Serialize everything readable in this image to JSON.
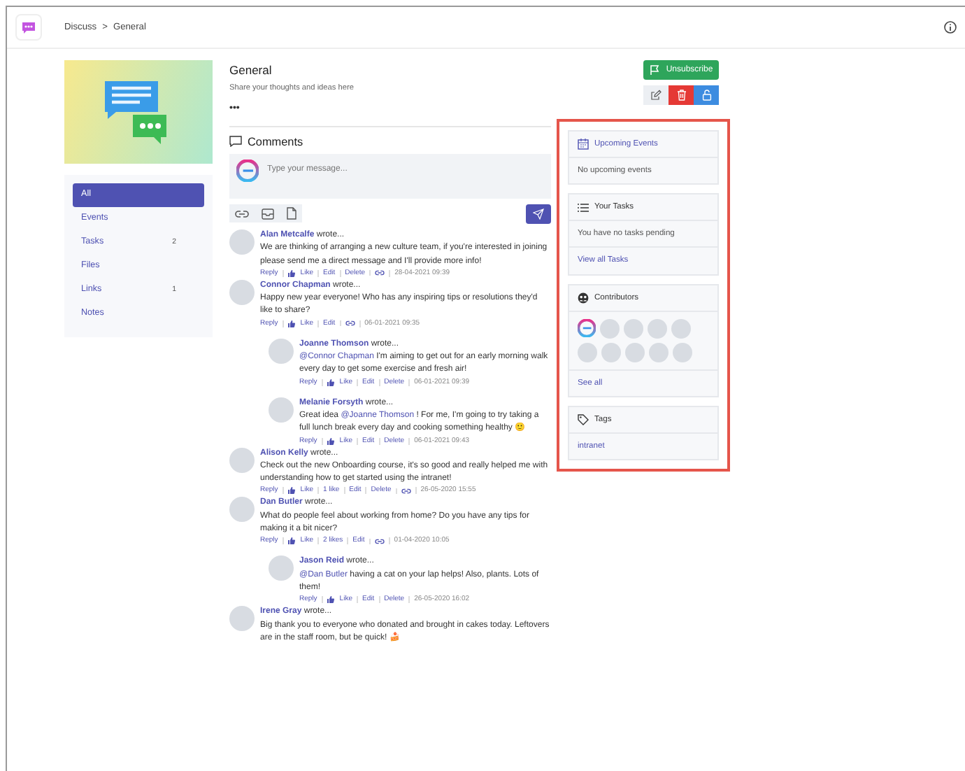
{
  "header": {
    "breadcrumb": [
      "Discuss",
      "General"
    ],
    "separator": ">"
  },
  "group": {
    "title": "General",
    "description": "Share your thoughts and ideas here",
    "menu": "•••"
  },
  "unsubscribe": "Unsubscribe",
  "icon_buttons": [
    {
      "kind": "edit"
    },
    {
      "kind": "delete"
    },
    {
      "kind": "lock"
    }
  ],
  "nav": [
    {
      "label": "All",
      "selected": true
    },
    {
      "label": "Events",
      "selected": false
    },
    {
      "label": "Tasks",
      "count": "2",
      "selected": false
    },
    {
      "label": "Files",
      "selected": false
    },
    {
      "label": "Links",
      "count": "1",
      "selected": false
    },
    {
      "label": "Notes",
      "selected": false
    }
  ],
  "comments_heading": "Comments",
  "composer": {
    "placeholder": "Type your message..."
  },
  "attach_tools": [
    {
      "kind": "link"
    },
    {
      "kind": "inbox"
    },
    {
      "kind": "file"
    }
  ],
  "comments": [
    {
      "author": "Alan Metcalfe",
      "wrote": "wrote...",
      "body": [
        {
          "kind": "text",
          "text": "We are thinking of arranging a new culture team, if you're interested in joining please send me a direct message and I'll provide more info!"
        }
      ],
      "actions": [
        {
          "kind": "reply",
          "text": "Reply"
        },
        {
          "kind": "like",
          "text": "Like"
        },
        {
          "kind": "edit",
          "text": "Edit"
        },
        {
          "kind": "delete",
          "text": "Delete"
        },
        {
          "kind": "permalink"
        },
        {
          "kind": "time",
          "text": "28-04-2021 09:39"
        }
      ]
    },
    {
      "author": "Connor Chapman",
      "wrote": "wrote...",
      "body": [
        {
          "kind": "text",
          "text": "Happy new year everyone! Who has any inspiring tips or resolutions they'd like to share?"
        }
      ],
      "actions": [
        {
          "kind": "reply",
          "text": "Reply"
        },
        {
          "kind": "like",
          "text": "Like"
        },
        {
          "kind": "edit",
          "text": "Edit"
        },
        {
          "kind": "permalink"
        },
        {
          "kind": "time",
          "text": "06-01-2021 09:35"
        }
      ],
      "replies": [
        {
          "author": "Joanne Thomson",
          "wrote": "wrote...",
          "body": [
            {
              "kind": "mention",
              "text": "@Connor Chapman"
            },
            {
              "kind": "text",
              "text": " I'm aiming to get out for an early morning walk every day to get some exercise and fresh air!"
            }
          ],
          "actions": [
            {
              "kind": "reply",
              "text": "Reply"
            },
            {
              "kind": "like",
              "text": "Like"
            },
            {
              "kind": "edit",
              "text": "Edit"
            },
            {
              "kind": "delete",
              "text": "Delete"
            },
            {
              "kind": "time",
              "text": "06-01-2021 09:39"
            }
          ]
        },
        {
          "author": "Melanie Forsyth",
          "wrote": "wrote...",
          "body": [
            {
              "kind": "text",
              "text": "Great idea "
            },
            {
              "kind": "mention",
              "text": "@Joanne Thomson"
            },
            {
              "kind": "text",
              "text": " ! For me, I'm going to try taking a full lunch break every day and cooking something healthy 🙂"
            }
          ],
          "actions": [
            {
              "kind": "reply",
              "text": "Reply"
            },
            {
              "kind": "like",
              "text": "Like"
            },
            {
              "kind": "edit",
              "text": "Edit"
            },
            {
              "kind": "delete",
              "text": "Delete"
            },
            {
              "kind": "time",
              "text": "06-01-2021 09:43"
            }
          ]
        }
      ]
    },
    {
      "author": "Alison Kelly",
      "wrote": "wrote...",
      "body": [
        {
          "kind": "text",
          "text": "Check out the new Onboarding course, it's so good and really helped me with understanding how to get started using the intranet!"
        }
      ],
      "actions": [
        {
          "kind": "reply",
          "text": "Reply"
        },
        {
          "kind": "like",
          "text": "Like"
        },
        {
          "kind": "count",
          "text": "1 like"
        },
        {
          "kind": "edit",
          "text": "Edit"
        },
        {
          "kind": "delete",
          "text": "Delete"
        },
        {
          "kind": "permalink"
        },
        {
          "kind": "time",
          "text": "26-05-2020 15:55"
        }
      ]
    },
    {
      "author": "Dan Butler",
      "wrote": "wrote...",
      "body": [
        {
          "kind": "text",
          "text": "What do people feel about working from home? Do you have any tips for making it a bit nicer?"
        }
      ],
      "actions": [
        {
          "kind": "reply",
          "text": "Reply"
        },
        {
          "kind": "like",
          "text": "Like"
        },
        {
          "kind": "count",
          "text": "2 likes"
        },
        {
          "kind": "edit",
          "text": "Edit"
        },
        {
          "kind": "permalink"
        },
        {
          "kind": "time",
          "text": "01-04-2020 10:05"
        }
      ],
      "replies": [
        {
          "author": "Jason Reid",
          "wrote": "wrote...",
          "body": [
            {
              "kind": "mention",
              "text": "@Dan Butler"
            },
            {
              "kind": "text",
              "text": " having a cat on your lap helps! Also, plants. Lots of them!"
            }
          ],
          "actions": [
            {
              "kind": "reply",
              "text": "Reply"
            },
            {
              "kind": "like",
              "text": "Like"
            },
            {
              "kind": "edit",
              "text": "Edit"
            },
            {
              "kind": "delete",
              "text": "Delete"
            },
            {
              "kind": "time",
              "text": "26-05-2020 16:02"
            }
          ]
        }
      ]
    },
    {
      "author": "Irene Gray",
      "wrote": "wrote...",
      "body": [
        {
          "kind": "text",
          "text": "Big thank you to everyone who donated and brought in cakes today. Leftovers are in the staff room, but be quick! 🍰"
        }
      ]
    }
  ],
  "panels": [
    {
      "kind": "events",
      "title": "Upcoming Events",
      "text": "No upcoming events"
    },
    {
      "kind": "tasks",
      "title": "Your Tasks",
      "text": "You have no tasks pending",
      "link": "View all Tasks"
    },
    {
      "kind": "contributors",
      "title": "Contributors",
      "avatars": [
        {
          "kind": "logo"
        },
        {
          "kind": "photo"
        },
        {
          "kind": "photo"
        },
        {
          "kind": "photo"
        },
        {
          "kind": "photo"
        },
        {
          "kind": "photo"
        },
        {
          "kind": "photo"
        },
        {
          "kind": "photo"
        },
        {
          "kind": "photo"
        },
        {
          "kind": "photo"
        }
      ],
      "link": "See all"
    },
    {
      "kind": "tags",
      "title": "Tags",
      "tags": [
        "intranet"
      ]
    }
  ]
}
